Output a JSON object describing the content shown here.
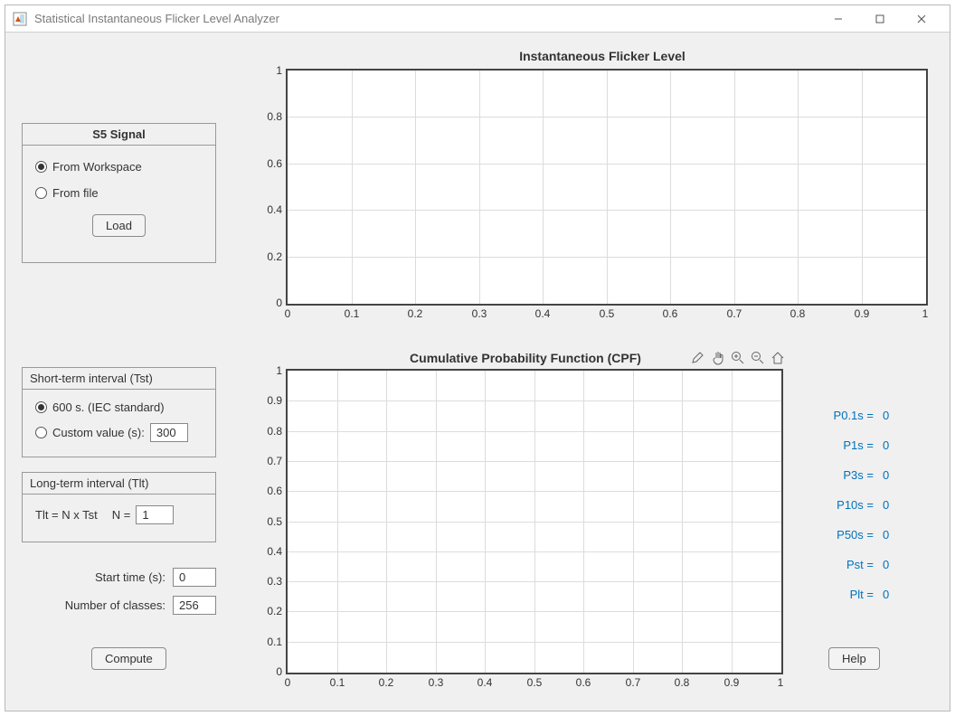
{
  "window": {
    "title": "Statistical Instantaneous Flicker Level Analyzer"
  },
  "s5_panel": {
    "header": "S5 Signal",
    "option_workspace": "From Workspace",
    "option_file": "From file",
    "load_btn": "Load"
  },
  "tst_panel": {
    "header": "Short-term interval  (Tst)",
    "option_standard": "600 s.  (IEC standard)",
    "option_custom_label": "Custom value (s):",
    "custom_value": "300"
  },
  "tlt_panel": {
    "header": "Long-term interval (Tlt)",
    "formula_label": "Tlt = N x Tst",
    "n_label": "N =",
    "n_value": "1"
  },
  "start_time": {
    "label": "Start time (s):",
    "value": "0"
  },
  "classes": {
    "label": "Number of classes:",
    "value": "256"
  },
  "compute_btn": "Compute",
  "help_btn": "Help",
  "chart1": {
    "title": "Instantaneous Flicker Level",
    "xticks": [
      "0",
      "0.1",
      "0.2",
      "0.3",
      "0.4",
      "0.5",
      "0.6",
      "0.7",
      "0.8",
      "0.9",
      "1"
    ],
    "yticks": [
      "0",
      "0.2",
      "0.4",
      "0.6",
      "0.8",
      "1"
    ]
  },
  "chart2": {
    "title": "Cumulative Probability Function (CPF)",
    "xticks": [
      "0",
      "0.1",
      "0.2",
      "0.3",
      "0.4",
      "0.5",
      "0.6",
      "0.7",
      "0.8",
      "0.9",
      "1"
    ],
    "yticks": [
      "0",
      "0.1",
      "0.2",
      "0.3",
      "0.4",
      "0.5",
      "0.6",
      "0.7",
      "0.8",
      "0.9",
      "1"
    ]
  },
  "stats": {
    "p01s": {
      "k": "P0.1s =",
      "v": "0"
    },
    "p1s": {
      "k": "P1s =",
      "v": "0"
    },
    "p3s": {
      "k": "P3s =",
      "v": "0"
    },
    "p10s": {
      "k": "P10s =",
      "v": "0"
    },
    "p50s": {
      "k": "P50s =",
      "v": "0"
    },
    "pst": {
      "k": "Pst =",
      "v": "0"
    },
    "plt": {
      "k": "Plt =",
      "v": "0"
    }
  },
  "chart_data": [
    {
      "type": "line",
      "title": "Instantaneous Flicker Level",
      "xlabel": "",
      "ylabel": "",
      "xlim": [
        0,
        1
      ],
      "ylim": [
        0,
        1
      ],
      "series": []
    },
    {
      "type": "line",
      "title": "Cumulative Probability Function (CPF)",
      "xlabel": "",
      "ylabel": "",
      "xlim": [
        0,
        1
      ],
      "ylim": [
        0,
        1
      ],
      "series": []
    }
  ]
}
